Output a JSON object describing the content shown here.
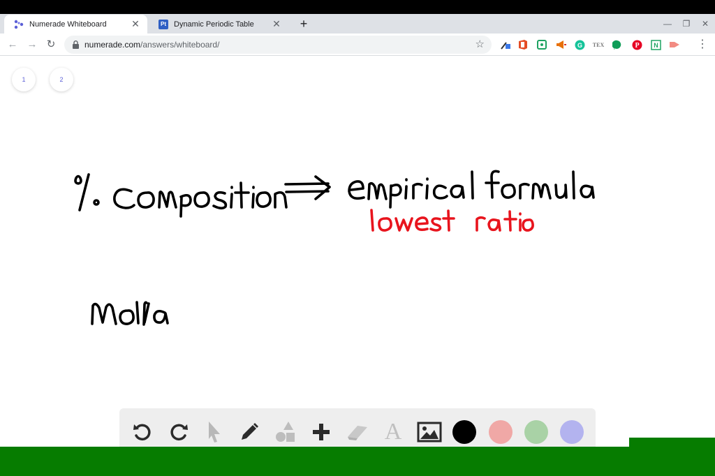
{
  "browser": {
    "tabs": [
      {
        "title": "Numerade Whiteboard",
        "active": true
      },
      {
        "title": "Dynamic Periodic Table",
        "active": false,
        "favicon_text": "Pt"
      }
    ],
    "url_host": "numerade.com",
    "url_path": "/answers/whiteboard/"
  },
  "whiteboard": {
    "pages": [
      "1",
      "2"
    ],
    "notes": {
      "line1_left": "% composition",
      "arrow": "⟹",
      "line1_right": "empirical formula",
      "line2_red": "lowest ratio",
      "line3": "Molar"
    },
    "ink_colors": {
      "black": "#000000",
      "red": "#e8141d"
    }
  },
  "drawing_toolbar": {
    "tools": [
      "undo-icon",
      "redo-icon",
      "pointer-icon",
      "pen-icon",
      "shapes-icon",
      "add-icon",
      "eraser-icon",
      "text-icon",
      "image-icon"
    ],
    "text_tool_glyph": "A",
    "colors": [
      "#000000",
      "#f0a8a6",
      "#a9d2a6",
      "#b3b3ef"
    ]
  },
  "colors": {
    "accent": "#5b5fd6",
    "green_bar": "#067c00"
  }
}
